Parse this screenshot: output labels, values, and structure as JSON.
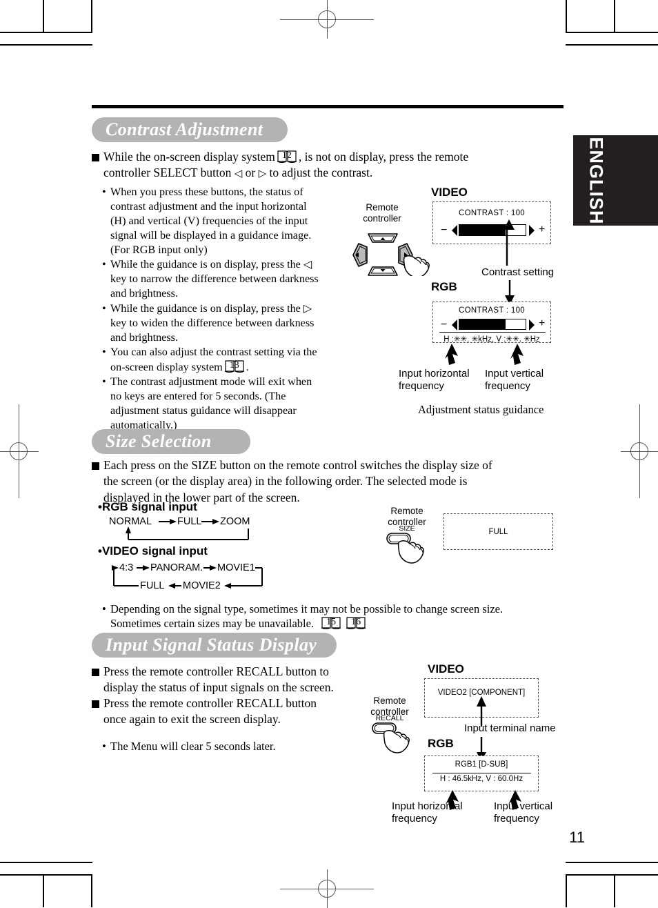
{
  "page": {
    "number": "11",
    "side_tab": "ENGLISH"
  },
  "sections": [
    {
      "id": "contrast-adjustment",
      "banner": "Contrast Adjustment",
      "intro": "While the on-screen display system 12 , is not on display, press the remote controller SELECT button ◁ or ▷ to adjust the contrast.",
      "intro_parts": {
        "a": "While the on-screen display system",
        "ref": "12",
        "b": ", is not on display, press the remote",
        "c": "controller SELECT button",
        "left_glyph": "◁",
        "or": "or",
        "right_glyph": "▷",
        "d": "to adjust the contrast."
      },
      "bullets": [
        "When you press these buttons, the status of contrast adjustment and the input horizontal (H) and vertical (V) frequencies of the input signal will be displayed in a guidance image. (For RGB input only)",
        "While the guidance is on display, press the ◁ key to narrow the difference between darkness and brightness.",
        "While the guidance is on display, press the ▷ key to widen the difference between darkness and brightness.",
        "You can also adjust the contrast setting via the on-screen display system 13 .",
        "The contrast adjustment mode will exit when no keys are entered for 5 seconds. (The adjustment status guidance will disappear automatically.)"
      ],
      "bullet_lines": [
        [
          "When you press these buttons, the status of",
          "contrast adjustment and the input horizontal",
          "(H) and vertical (V) frequencies of the input",
          "signal will be displayed in a guidance image.",
          "(For RGB input only)"
        ],
        [
          "While the guidance is on display, press the ◁",
          "key to narrow the difference between darkness",
          "and brightness."
        ],
        [
          "While the guidance is on display, press the ▷",
          "key to widen the difference between darkness",
          "and brightness."
        ],
        [
          "You can also adjust the contrast setting via the",
          "on-screen display system"
        ],
        [
          "The contrast adjustment mode will exit when",
          "no keys are entered for 5 seconds. (The",
          "adjustment status guidance will disappear",
          "automatically.)"
        ]
      ],
      "bullet_ref": "13",
      "figure": {
        "remote_label_line1": "Remote",
        "remote_label_line2": "controller",
        "video_heading": "VIDEO",
        "rgb_heading": "RGB",
        "video_osd": {
          "title": "CONTRAST : 100",
          "minus": "−",
          "plus": "+",
          "fill_percent": 70
        },
        "rgb_osd": {
          "title": "CONTRAST : 100",
          "minus": "−",
          "plus": "+",
          "fill_percent": 70,
          "freq_line": "H :✳✳. ✳kHz, V :✳✳. ✳Hz"
        },
        "callout_contrast": "Contrast setting",
        "callout_hfreq_line1": "Input horizontal",
        "callout_hfreq_line2": "frequency",
        "callout_vfreq_line1": "Input vertical",
        "callout_vfreq_line2": "frequency",
        "caption": "Adjustment status guidance"
      }
    },
    {
      "id": "size-selection",
      "banner": "Size Selection",
      "intro_lines": [
        "Each press on the SIZE button on the remote control switches the display size of",
        "the screen (or the display area) in the following order. The selected mode is",
        "displayed in the lower part of the screen."
      ],
      "rgb_heading": "•RGB signal input",
      "rgb_flow": [
        "NORMAL",
        "FULL",
        "ZOOM"
      ],
      "video_heading": "•VIDEO signal input",
      "video_flow_top": [
        "4:3",
        "PANORAM.",
        "MOVIE1"
      ],
      "video_flow_bottom": [
        "FULL",
        "MOVIE2"
      ],
      "note_lines": [
        "Depending on the signal type, sometimes it may not be possible to change screen size.",
        "Sometimes certain sizes may be unavailable."
      ],
      "note_refs": [
        "15",
        "16"
      ],
      "figure": {
        "remote_label_line1": "Remote",
        "remote_label_line2": "controller",
        "button_label": "SIZE",
        "osd_text": "FULL"
      }
    },
    {
      "id": "input-signal-status-display",
      "banner": "Input Signal Status Display",
      "bullets_lines": [
        [
          "Press the remote controller RECALL button to",
          "display the status of input signals on the screen."
        ],
        [
          "Press the remote controller RECALL button",
          "once again to exit the screen display."
        ]
      ],
      "note": "The Menu will clear 5 seconds later.",
      "figure": {
        "remote_label_line1": "Remote",
        "remote_label_line2": "controller",
        "button_label": "RECALL",
        "video_heading": "VIDEO",
        "rgb_heading": "RGB",
        "video_osd_text": "VIDEO2  [COMPONENT]",
        "rgb_osd_title": "RGB1  [D-SUB]",
        "rgb_osd_freq": "H : 46.5kHz, V : 60.0Hz",
        "callout_terminal": "Input terminal name",
        "callout_hfreq_line1": "Input horizontal",
        "callout_hfreq_line2": "frequency",
        "callout_vfreq_line1": "Input vertical",
        "callout_vfreq_line2": "frequency"
      }
    }
  ],
  "colors": {
    "banner_bg": "#b3b3b3",
    "tab_bg": "#231f20",
    "ink": "#000000",
    "dash": "#4d4d4d"
  }
}
